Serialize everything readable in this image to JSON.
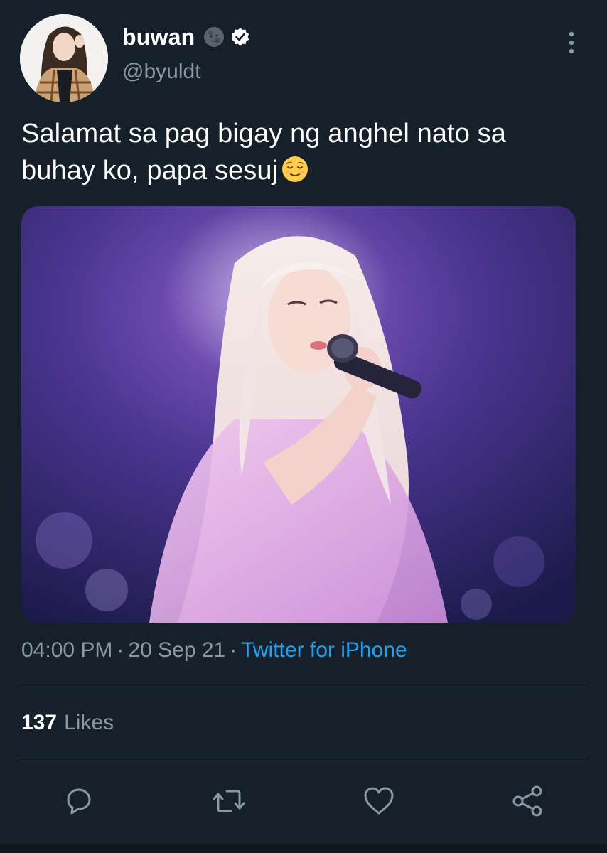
{
  "user": {
    "display_name": "buwan",
    "name_emoji_icon": "new-moon-face-icon",
    "verified_icon": "verified-badge-icon",
    "handle": "@byuldt"
  },
  "tweet": {
    "text": "Salamat sa pag bigay ng anghel nato sa buhay ko, papa sesuj",
    "text_emoji_icon": "relieved-face-icon",
    "time": "04:00 PM",
    "separator": "·",
    "date": "20 Sep 21",
    "source": "Twitter for iPhone"
  },
  "stats": {
    "likes_count": "137",
    "likes_label": "Likes"
  },
  "actions": [
    {
      "name": "reply",
      "icon": "reply-icon"
    },
    {
      "name": "retweet",
      "icon": "retweet-icon"
    },
    {
      "name": "like",
      "icon": "heart-icon"
    },
    {
      "name": "share",
      "icon": "share-icon"
    }
  ],
  "colors": {
    "background": "#15202b",
    "primary_text": "#ffffff",
    "secondary_text": "#8899a6",
    "link": "#1da1f2",
    "divider": "#38444d",
    "verified_badge": "#ffffff"
  }
}
